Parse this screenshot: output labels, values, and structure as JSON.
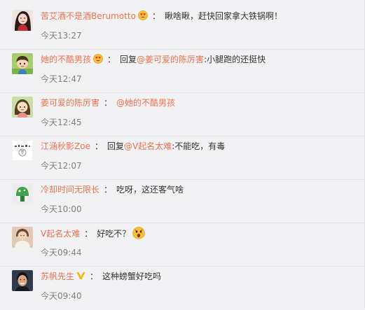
{
  "comments": [
    {
      "user": "苦艾酒不是酒Berumotto",
      "user_emoji": "heart-eyes-emoji-icon",
      "separator": "：",
      "text": "瞅啥瞅，赶快回家拿大铁锅啊！",
      "time": "今天13:27"
    },
    {
      "user": "她的不酷男孩",
      "user_emoji": "heart-eyes-emoji-icon",
      "separator": "：",
      "reply_label": "回复",
      "mention": "@姜可爱的陈厉害",
      "text": ":小腿跑的还挺快",
      "time": "今天12:47"
    },
    {
      "user": "姜可爱的陈厉害",
      "separator": "：",
      "mention": "@她的不酷男孩",
      "time": "今天12:45"
    },
    {
      "user": "江涵秋影Zoe",
      "separator": "：",
      "reply_label": "回复",
      "mention": "@V起名太难",
      "text": ":不能吃，有毒",
      "time": "今天12:07"
    },
    {
      "user": "冷却时间无限长",
      "separator": "：",
      "text": "吃呀，这还客气啥",
      "time": "今天10:00"
    },
    {
      "user": "V起名太难",
      "separator": "：",
      "text": "好吃不？",
      "text_emoji": "surprised-emoji-icon",
      "time": "今天09:44"
    },
    {
      "user": "苏帆先生",
      "user_badge": "vip-v-icon",
      "separator": "：",
      "text": "这种螃蟹好吃吗",
      "time": "今天09:40"
    }
  ],
  "colors": {
    "username": "#eb7350",
    "text": "#333333",
    "time": "#808080",
    "background": "#f2f2f5",
    "vip_badge": "#f7b500"
  }
}
